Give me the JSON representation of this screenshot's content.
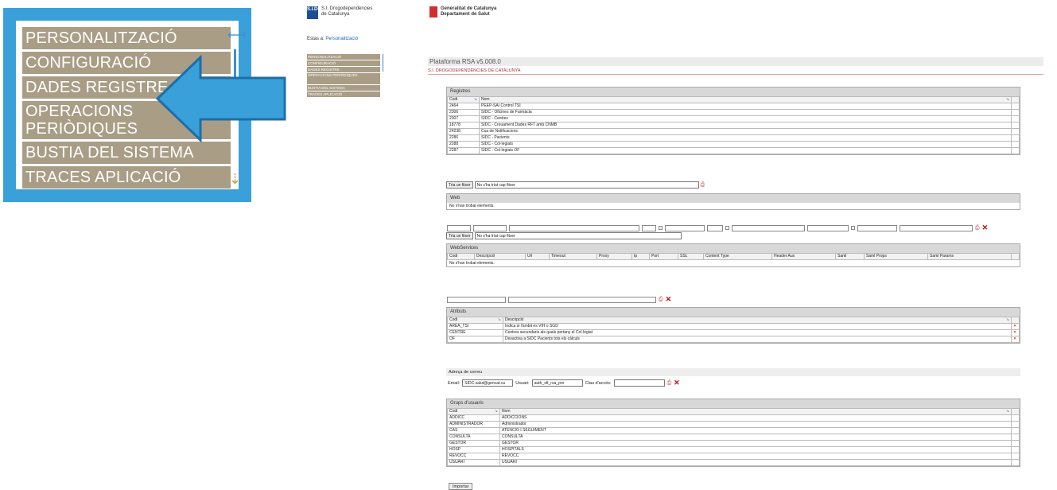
{
  "zoom_menu": {
    "items": [
      "PERSONALITZACIÓ",
      "CONFIGURACIÓ",
      "DADES REGISTRE",
      "OPERACIONS PERIÒDIQUES",
      "BUSTIA DEL SISTEMA",
      "TRACES APLICACIÓ"
    ]
  },
  "small_header": {
    "logo_letters": "S.I.DC",
    "org_line1": "S.I. Drogodependències",
    "org_line2": "de Catalunya",
    "estas_label": "Estas a:",
    "estas_link": "Personalització",
    "menu": [
      "PERSONALITZACIÓ",
      "CONFIGURACIÓ",
      "DADES REGISTRE",
      "OPERACIONS PERIÒDIQUES",
      "BUSTIA DEL SISTEMA",
      "TRACES APLICACIÓ"
    ]
  },
  "header": {
    "gen_line1": "Generalitat de Catalunya",
    "gen_line2": "Departament de Salut",
    "platform": "Plataforma RSA v5.008.0",
    "organization": "S.I. DROGODEPENDÈNCIES DE CATALUNYA"
  },
  "registres": {
    "title": "Registres",
    "columns": [
      "Codi",
      "Nom"
    ],
    "rows": [
      [
        "2464",
        "PEEP-SAI Control TSI"
      ],
      [
        "2306",
        "SIDC - Oficines de Farmàcia"
      ],
      [
        "2307",
        "SIDC - Centres"
      ],
      [
        "18778",
        "SIDC - Creuament Dades RFT amb CNMB"
      ],
      [
        "24238",
        "Cua de Notificacions"
      ],
      [
        "2286",
        "SIDC - Pacients"
      ],
      [
        "2288",
        "SIDC - Col·legiats"
      ],
      [
        "2287",
        "SIDC - Col·legiats OF"
      ]
    ]
  },
  "file1": {
    "button": "Tria un fitxer",
    "status": "No s'ha triat cap fitxer"
  },
  "web": {
    "title": "Web",
    "empty": "No s'han trobat elements."
  },
  "file2": {
    "button": "Tria un fitxer",
    "status": "No s'ha triat cap fitxer"
  },
  "webservices": {
    "title": "WebServices",
    "columns": [
      "Codi",
      "Descripció",
      "Url",
      "Timeout",
      "Proxy",
      "Ip",
      "Port",
      "SSL",
      "Content Type",
      "Header Aux",
      "Saml",
      "Saml Props",
      "Saml Params"
    ],
    "empty": "No s'han trobat elements."
  },
  "atributs": {
    "title": "Atributs",
    "columns": [
      "Codi",
      "Descripció"
    ],
    "rows": [
      [
        "AREA_TSI",
        "Indica si l'àmbit és VIH o SGD"
      ],
      [
        "CENTRE",
        "Centres secundaris als quals pertany el Col·legiat"
      ],
      [
        "OF",
        "Desactiva a SIDC Pacients tots els càlculs"
      ]
    ]
  },
  "mail": {
    "title": "Adreça de correu",
    "email_label": "Email:",
    "email_value": "SIDC.salut@gencat.ca",
    "user_label": "Usuari:",
    "user_value": "auth_sft_rsa_pro",
    "key_label": "Clau d'accés:"
  },
  "grups": {
    "title": "Grups d'usuaris",
    "columns": [
      "Codi",
      "Nom"
    ],
    "rows": [
      [
        "ADDICC",
        "ADDICCIONS"
      ],
      [
        "ADMINISTRADOR",
        "Administrador"
      ],
      [
        "CAS",
        "ATENCIÓ I SEGUIMENT"
      ],
      [
        "CONSULTA",
        "CONSULTA"
      ],
      [
        "GESTOR",
        "GESTOR"
      ],
      [
        "HOSP",
        "HOSPITALS"
      ],
      [
        "REVOCC",
        "REVOCC"
      ],
      [
        "USUARI",
        "USUARI"
      ]
    ]
  },
  "import_button": "Importar"
}
